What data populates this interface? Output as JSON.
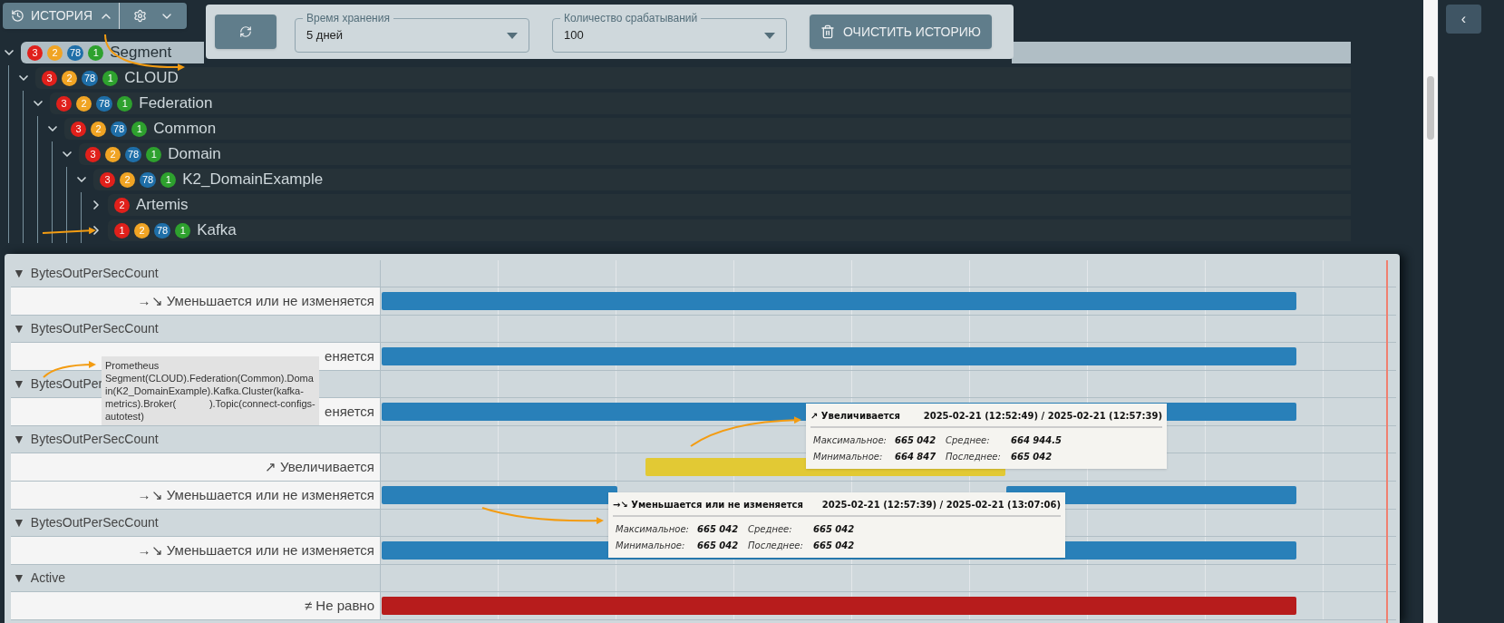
{
  "history_button": {
    "label": "ИСТОРИЯ",
    "expanded": true
  },
  "toolbar": {
    "retention": {
      "label": "Время хранения",
      "value": "5 дней"
    },
    "count": {
      "label": "Количество срабатываний",
      "value": "100"
    },
    "clear_button": "ОЧИСТИТЬ ИСТОРИЮ"
  },
  "tree": [
    {
      "label": "Segment",
      "selected": true,
      "expanded": true,
      "badges": [
        {
          "count": "3",
          "color": "#e0201b"
        },
        {
          "count": "2",
          "color": "#f0a424"
        },
        {
          "count": "78",
          "color": "#1f6fa8"
        },
        {
          "count": "1",
          "color": "#2ea12e"
        }
      ],
      "children": [
        {
          "label": "CLOUD",
          "selected": false,
          "expanded": true,
          "badges": [
            {
              "count": "3",
              "color": "#e0201b"
            },
            {
              "count": "2",
              "color": "#f0a424"
            },
            {
              "count": "78",
              "color": "#1f6fa8"
            },
            {
              "count": "1",
              "color": "#2ea12e"
            }
          ],
          "children": [
            {
              "label": "Federation",
              "selected": false,
              "expanded": true,
              "badges": [
                {
                  "count": "3",
                  "color": "#e0201b"
                },
                {
                  "count": "2",
                  "color": "#f0a424"
                },
                {
                  "count": "78",
                  "color": "#1f6fa8"
                },
                {
                  "count": "1",
                  "color": "#2ea12e"
                }
              ],
              "children": [
                {
                  "label": "Common",
                  "selected": false,
                  "expanded": true,
                  "badges": [
                    {
                      "count": "3",
                      "color": "#e0201b"
                    },
                    {
                      "count": "2",
                      "color": "#f0a424"
                    },
                    {
                      "count": "78",
                      "color": "#1f6fa8"
                    },
                    {
                      "count": "1",
                      "color": "#2ea12e"
                    }
                  ],
                  "children": [
                    {
                      "label": "Domain",
                      "selected": false,
                      "expanded": true,
                      "badges": [
                        {
                          "count": "3",
                          "color": "#e0201b"
                        },
                        {
                          "count": "2",
                          "color": "#f0a424"
                        },
                        {
                          "count": "78",
                          "color": "#1f6fa8"
                        },
                        {
                          "count": "1",
                          "color": "#2ea12e"
                        }
                      ],
                      "children": [
                        {
                          "label": "K2_DomainExample",
                          "selected": false,
                          "expanded": true,
                          "badges": [
                            {
                              "count": "3",
                              "color": "#e0201b"
                            },
                            {
                              "count": "2",
                              "color": "#f0a424"
                            },
                            {
                              "count": "78",
                              "color": "#1f6fa8"
                            },
                            {
                              "count": "1",
                              "color": "#2ea12e"
                            }
                          ],
                          "children": [
                            {
                              "label": "Artemis",
                              "selected": false,
                              "expanded": false,
                              "badges": [
                                {
                                  "count": "2",
                                  "color": "#e0201b"
                                }
                              ]
                            },
                            {
                              "label": "Kafka",
                              "selected": false,
                              "expanded": false,
                              "badges": [
                                {
                                  "count": "1",
                                  "color": "#e0201b"
                                },
                                {
                                  "count": "2",
                                  "color": "#f0a424"
                                },
                                {
                                  "count": "78",
                                  "color": "#1f6fa8"
                                },
                                {
                                  "count": "1",
                                  "color": "#2ea12e"
                                }
                              ]
                            }
                          ]
                        }
                      ]
                    }
                  ]
                }
              ]
            }
          ]
        }
      ]
    }
  ],
  "timeline": [
    {
      "toggle": "▼",
      "title": "BytesOutPerSecCount",
      "items": [
        {
          "label": "→↘ Уменьшается или не изменяется",
          "bars": [
            {
              "kind": "full",
              "color": "#2980b9"
            }
          ]
        }
      ]
    },
    {
      "toggle": "▼",
      "title": "BytesOutPerSecCount",
      "items": [
        {
          "label": "еняется",
          "bars": [
            {
              "kind": "full",
              "color": "#2980b9"
            }
          ]
        }
      ]
    },
    {
      "toggle": "▼",
      "title": "BytesOutPer",
      "items": [
        {
          "label": "еняется",
          "bars": [
            {
              "kind": "full",
              "color": "#2980b9"
            }
          ]
        }
      ]
    },
    {
      "toggle": "▼",
      "title": "BytesOutPerSecCount",
      "items": [
        {
          "label": "↗ Увеличивается",
          "bars": [
            {
              "kind": "middle",
              "color": "#e2c934"
            }
          ]
        },
        {
          "label": "→↘ Уменьшается или не изменяется",
          "bars": [
            {
              "kind": "start",
              "color": "#2980b9"
            },
            {
              "kind": "end",
              "color": "#2980b9"
            }
          ]
        }
      ]
    },
    {
      "toggle": "▼",
      "title": "BytesOutPerSecCount",
      "items": [
        {
          "label": "→↘ Уменьшается или не изменяется",
          "bars": [
            {
              "kind": "full",
              "color": "#2980b9"
            }
          ]
        }
      ]
    },
    {
      "toggle": "▼",
      "title": "Active",
      "items": [
        {
          "label": "≠ Не равно",
          "bars": [
            {
              "kind": "full",
              "color": "#b71c1c"
            }
          ]
        }
      ]
    }
  ],
  "path_tooltip": "Prometheus\nSegment(CLOUD).Federation(Common).Domain(K2_DomainExample).Kafka.Cluster(kafka-metrics).Broker(            ).Topic(connect-configs-autotest)",
  "stat_tooltips": [
    {
      "trend": "↗ Увеличивается",
      "period": "2025-02-21 (12:52:49) / 2025-02-21 (12:57:39)",
      "stats": [
        {
          "label": "Максимальное:",
          "value": "665 042"
        },
        {
          "label": "Среднее:",
          "value": "664 944.5"
        },
        {
          "label": "Минимальное:",
          "value": "664 847"
        },
        {
          "label": "Последнее:",
          "value": "665 042"
        }
      ]
    },
    {
      "trend": "→↘ Уменьшается или не изменяется",
      "period": "2025-02-21 (12:57:39) / 2025-02-21 (13:07:06)",
      "stats": [
        {
          "label": "Максимальное:",
          "value": "665 042"
        },
        {
          "label": "Среднее:",
          "value": "665 042"
        },
        {
          "label": "Минимальное:",
          "value": "665 042"
        },
        {
          "label": "Последнее:",
          "value": "665 042"
        }
      ]
    }
  ],
  "sidebar_toggle": "‹"
}
